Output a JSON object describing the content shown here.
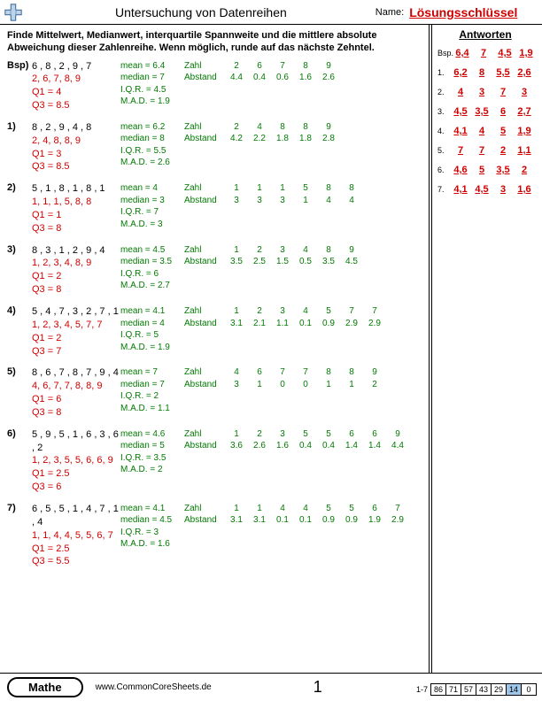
{
  "header": {
    "title": "Untersuchung von Datenreihen",
    "name_label": "Name:",
    "key": "Lösungsschlüssel"
  },
  "instructions": "Finde Mittelwert, Medianwert, interquartile Spannweite und die mittlere absolute Abweichung dieser Zahlenreihe. Wenn möglich, runde auf das nächste Zehntel.",
  "labels": {
    "mean": "mean =",
    "median": "median =",
    "iqr": "I.Q.R. =",
    "mad": "M.A.D. =",
    "zahl": "Zahl",
    "abstand": "Abstand",
    "q1": "Q1 =",
    "q3": "Q3 ="
  },
  "example_label": "Bsp)",
  "problems": [
    {
      "label": "Bsp)",
      "data": "6 , 8 , 2 , 9 , 7",
      "sorted": "2, 6, 7, 8, 9",
      "q1": "4",
      "q3": "8.5",
      "mean": "6.4",
      "median": "7",
      "iqr": "4.5",
      "mad": "1.9",
      "zahl": [
        "2",
        "6",
        "7",
        "8",
        "9"
      ],
      "abstand": [
        "4.4",
        "0.4",
        "0.6",
        "1.6",
        "2.6"
      ]
    },
    {
      "label": "1)",
      "data": "8 , 2 , 9 , 4 , 8",
      "sorted": "2, 4, 8, 8, 9",
      "q1": "3",
      "q3": "8.5",
      "mean": "6.2",
      "median": "8",
      "iqr": "5.5",
      "mad": "2.6",
      "zahl": [
        "2",
        "4",
        "8",
        "8",
        "9"
      ],
      "abstand": [
        "4.2",
        "2.2",
        "1.8",
        "1.8",
        "2.8"
      ]
    },
    {
      "label": "2)",
      "data": "5 , 1 , 8 , 1 , 8 , 1",
      "sorted": "1, 1, 1, 5, 8, 8",
      "q1": "1",
      "q3": "8",
      "mean": "4",
      "median": "3",
      "iqr": "7",
      "mad": "3",
      "zahl": [
        "1",
        "1",
        "1",
        "5",
        "8",
        "8"
      ],
      "abstand": [
        "3",
        "3",
        "3",
        "1",
        "4",
        "4"
      ]
    },
    {
      "label": "3)",
      "data": "8 , 3 , 1 , 2 , 9 , 4",
      "sorted": "1, 2, 3, 4, 8, 9",
      "q1": "2",
      "q3": "8",
      "mean": "4.5",
      "median": "3.5",
      "iqr": "6",
      "mad": "2.7",
      "zahl": [
        "1",
        "2",
        "3",
        "4",
        "8",
        "9"
      ],
      "abstand": [
        "3.5",
        "2.5",
        "1.5",
        "0.5",
        "3.5",
        "4.5"
      ]
    },
    {
      "label": "4)",
      "data": "5 , 4 , 7 , 3 , 2 , 7 , 1",
      "sorted": "1, 2, 3, 4, 5, 7, 7",
      "q1": "2",
      "q3": "7",
      "mean": "4.1",
      "median": "4",
      "iqr": "5",
      "mad": "1.9",
      "zahl": [
        "1",
        "2",
        "3",
        "4",
        "5",
        "7",
        "7"
      ],
      "abstand": [
        "3.1",
        "2.1",
        "1.1",
        "0.1",
        "0.9",
        "2.9",
        "2.9"
      ]
    },
    {
      "label": "5)",
      "data": "8 , 6 , 7 , 8 , 7 , 9 , 4",
      "sorted": "4, 6, 7, 7, 8, 8, 9",
      "q1": "6",
      "q3": "8",
      "mean": "7",
      "median": "7",
      "iqr": "2",
      "mad": "1.1",
      "zahl": [
        "4",
        "6",
        "7",
        "7",
        "8",
        "8",
        "9"
      ],
      "abstand": [
        "3",
        "1",
        "0",
        "0",
        "1",
        "1",
        "2"
      ]
    },
    {
      "label": "6)",
      "data": "5 , 9 , 5 , 1 , 6 , 3 , 6 , 2",
      "sorted": "1, 2, 3, 5, 5, 6, 6, 9",
      "q1": "2.5",
      "q3": "6",
      "mean": "4.6",
      "median": "5",
      "iqr": "3.5",
      "mad": "2",
      "zahl": [
        "1",
        "2",
        "3",
        "5",
        "5",
        "6",
        "6",
        "9"
      ],
      "abstand": [
        "3.6",
        "2.6",
        "1.6",
        "0.4",
        "0.4",
        "1.4",
        "1.4",
        "4.4"
      ]
    },
    {
      "label": "7)",
      "data": "6 , 5 , 5 , 1 , 4 , 7 , 1 , 4",
      "sorted": "1, 1, 4, 4, 5, 5, 6, 7",
      "q1": "2.5",
      "q3": "5.5",
      "mean": "4.1",
      "median": "4.5",
      "iqr": "3",
      "mad": "1.6",
      "zahl": [
        "1",
        "1",
        "4",
        "4",
        "5",
        "5",
        "6",
        "7"
      ],
      "abstand": [
        "3.1",
        "3.1",
        "0.1",
        "0.1",
        "0.9",
        "0.9",
        "1.9",
        "2.9"
      ]
    }
  ],
  "sidebar": {
    "title": "Antworten",
    "rows": [
      {
        "lab": "Bsp.",
        "vals": [
          "6,4",
          "7",
          "4,5",
          "1,9"
        ]
      },
      {
        "lab": "1.",
        "vals": [
          "6,2",
          "8",
          "5,5",
          "2,6"
        ]
      },
      {
        "lab": "2.",
        "vals": [
          "4",
          "3",
          "7",
          "3"
        ]
      },
      {
        "lab": "3.",
        "vals": [
          "4,5",
          "3,5",
          "6",
          "2,7"
        ]
      },
      {
        "lab": "4.",
        "vals": [
          "4,1",
          "4",
          "5",
          "1,9"
        ]
      },
      {
        "lab": "5.",
        "vals": [
          "7",
          "7",
          "2",
          "1,1"
        ]
      },
      {
        "lab": "6.",
        "vals": [
          "4,6",
          "5",
          "3,5",
          "2"
        ]
      },
      {
        "lab": "7.",
        "vals": [
          "4,1",
          "4,5",
          "3",
          "1,6"
        ]
      }
    ]
  },
  "footer": {
    "badge": "Mathe",
    "url": "www.CommonCoreSheets.de",
    "page": "1",
    "range": "1-7",
    "scores": [
      "86",
      "71",
      "57",
      "43",
      "29",
      "14",
      "0"
    ],
    "highlight_index": 5
  }
}
